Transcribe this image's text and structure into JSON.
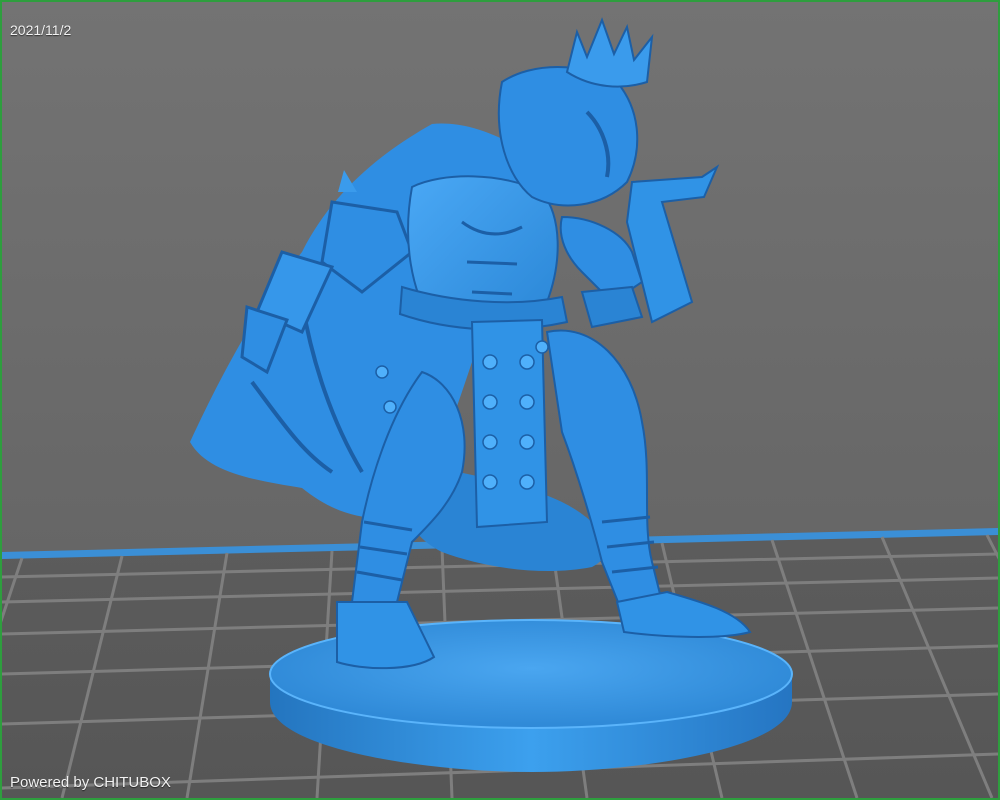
{
  "viewer": {
    "date": "2021/11/2",
    "watermark": "Powered by CHITUBOX"
  },
  "colors": {
    "background": "#6f6f6f",
    "floor": "#5f5f5f",
    "grid_line": "#8a8a8a",
    "plate_edge": "#3b8fd6",
    "model": "#2f8fe3",
    "model_shadow": "#1c5fa6",
    "model_highlight": "#69b8ff",
    "frame": "#2e9e3e"
  },
  "icons": {
    "model": "miniature-model-icon"
  }
}
